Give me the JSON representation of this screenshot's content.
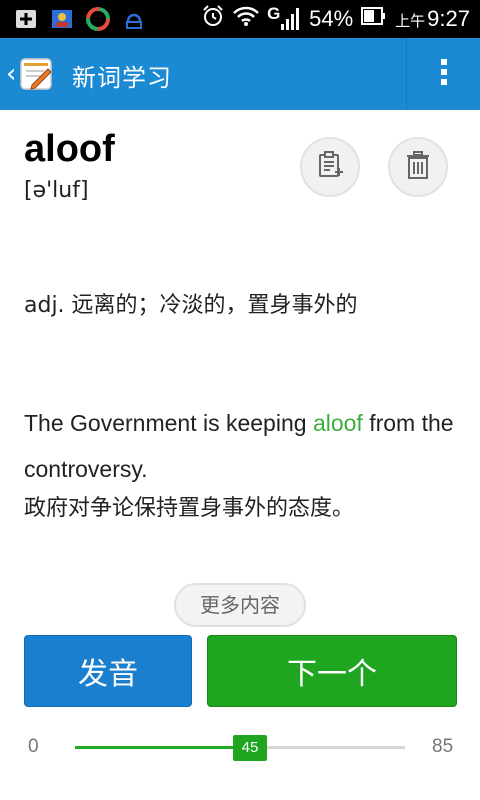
{
  "status_bar": {
    "battery": "54%",
    "ampm": "上午",
    "time": "9:27",
    "network": "G",
    "icons": [
      "add-box-icon",
      "photo-icon",
      "sync-app-icon",
      "download-icon",
      "alarm-icon",
      "wifi-icon",
      "signal-icon",
      "battery-icon"
    ]
  },
  "action_bar": {
    "title": "新词学习",
    "back_icon": "chevron-left-icon",
    "logo_icon": "notebook-pencil-icon",
    "menu_icon": "overflow-menu-icon",
    "color": "#1b8ad3"
  },
  "word": {
    "text": "aloof",
    "phonetic": "[ə'luf]"
  },
  "actions": {
    "add_icon": "add-to-wordbook-icon",
    "delete_icon": "trash-icon"
  },
  "definition": "adj. 远离的；冷淡的，置身事外的",
  "example": {
    "before": "The Government is keeping ",
    "highlight": "aloof",
    "after": " from the controversy.",
    "translation": "政府对争论保持置身事外的态度。",
    "highlight_color": "#3cae3c"
  },
  "more_button": "更多内容",
  "buttons": {
    "pronounce": "发音",
    "next": "下一个"
  },
  "progress": {
    "min": "0",
    "max": "85",
    "current": "45",
    "fraction": 0.53
  }
}
